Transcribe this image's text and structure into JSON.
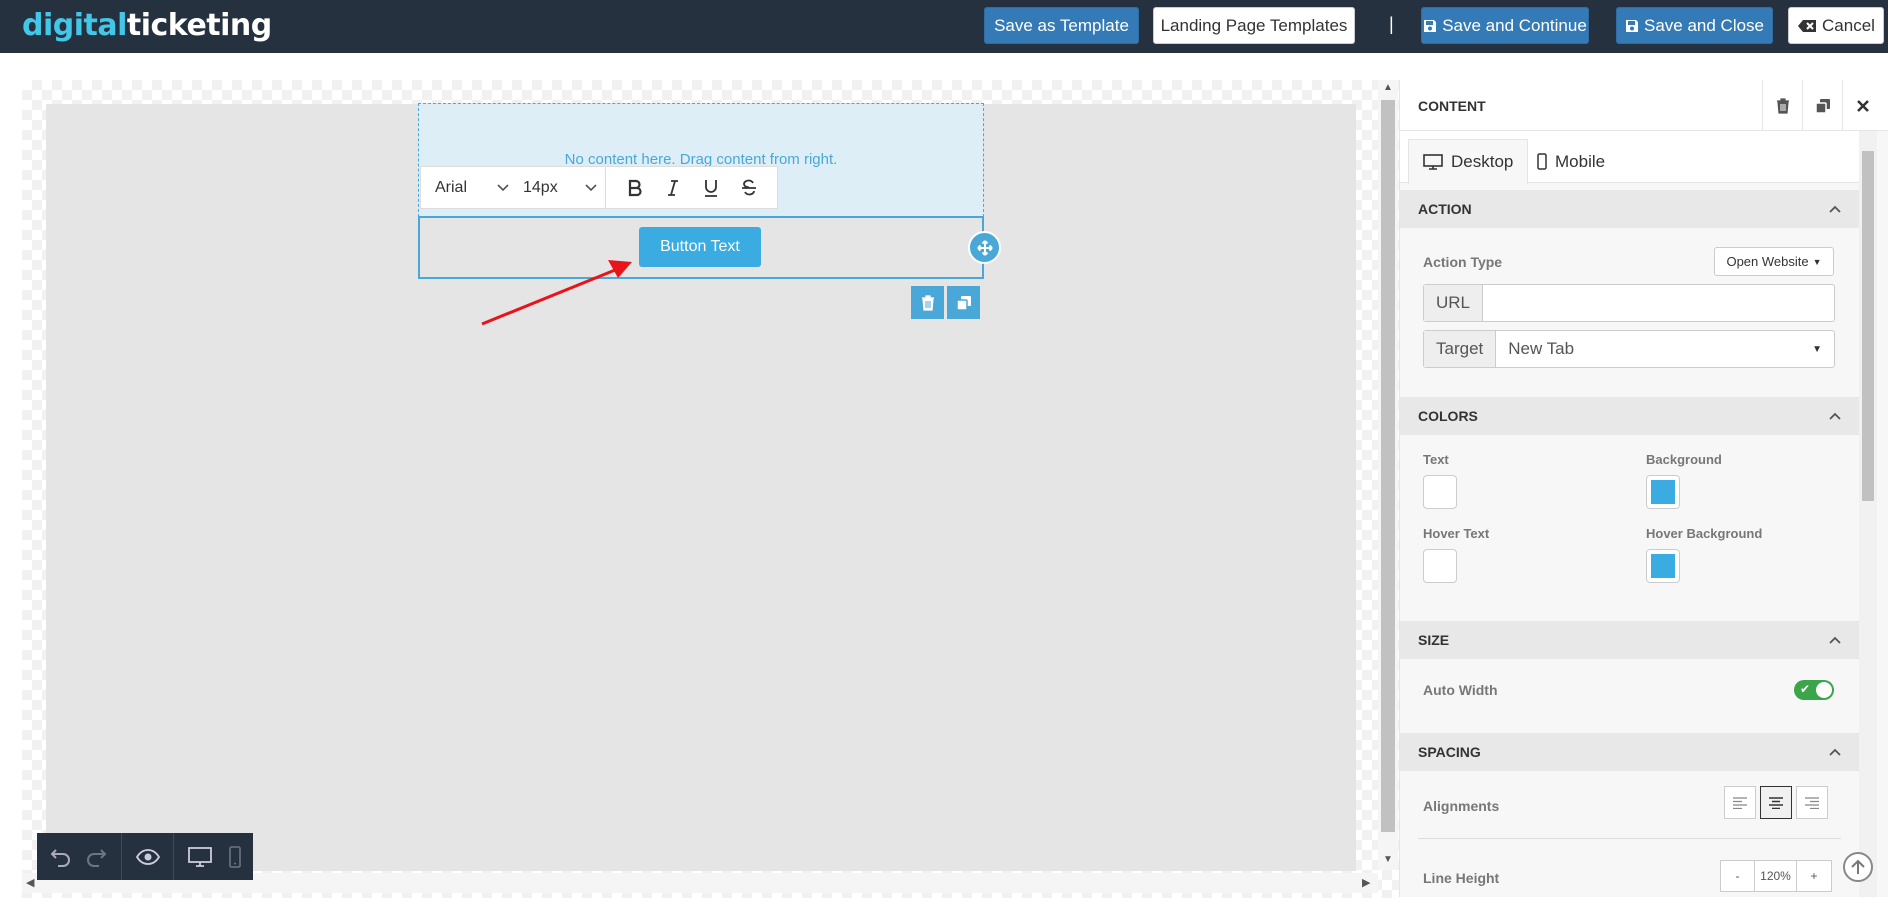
{
  "header": {
    "logo_part1": "digital",
    "logo_part2": "ticketing",
    "save_template": "Save as Template",
    "landing_templates": "Landing Page Templates",
    "separator": "|",
    "save_continue": "Save and Continue",
    "save_close": "Save and Close",
    "cancel": "Cancel"
  },
  "canvas": {
    "drop_placeholder": "No content here. Drag content from right.",
    "font_family": "Arial",
    "font_size": "14px",
    "button_text": "Button Text"
  },
  "panel": {
    "title": "CONTENT",
    "tabs": {
      "desktop": "Desktop",
      "mobile": "Mobile"
    },
    "action": {
      "header": "ACTION",
      "type_label": "Action Type",
      "type_value": "Open Website",
      "url_label": "URL",
      "url_value": "",
      "target_label": "Target",
      "target_value": "New Tab"
    },
    "colors": {
      "header": "COLORS",
      "text_label": "Text",
      "background_label": "Background",
      "hover_text_label": "Hover Text",
      "hover_background_label": "Hover Background",
      "text_color": "#ffffff",
      "background_color": "#3aace2",
      "hover_text_color": "#ffffff",
      "hover_background_color": "#3aace2"
    },
    "size": {
      "header": "SIZE",
      "auto_width_label": "Auto Width",
      "auto_width": true
    },
    "spacing": {
      "header": "SPACING",
      "alignments_label": "Alignments",
      "line_height_label": "Line Height",
      "line_height_value": "120%",
      "minus": "-",
      "plus": "+"
    }
  },
  "accent_color": "#3aace2",
  "topbar_color": "#263140"
}
